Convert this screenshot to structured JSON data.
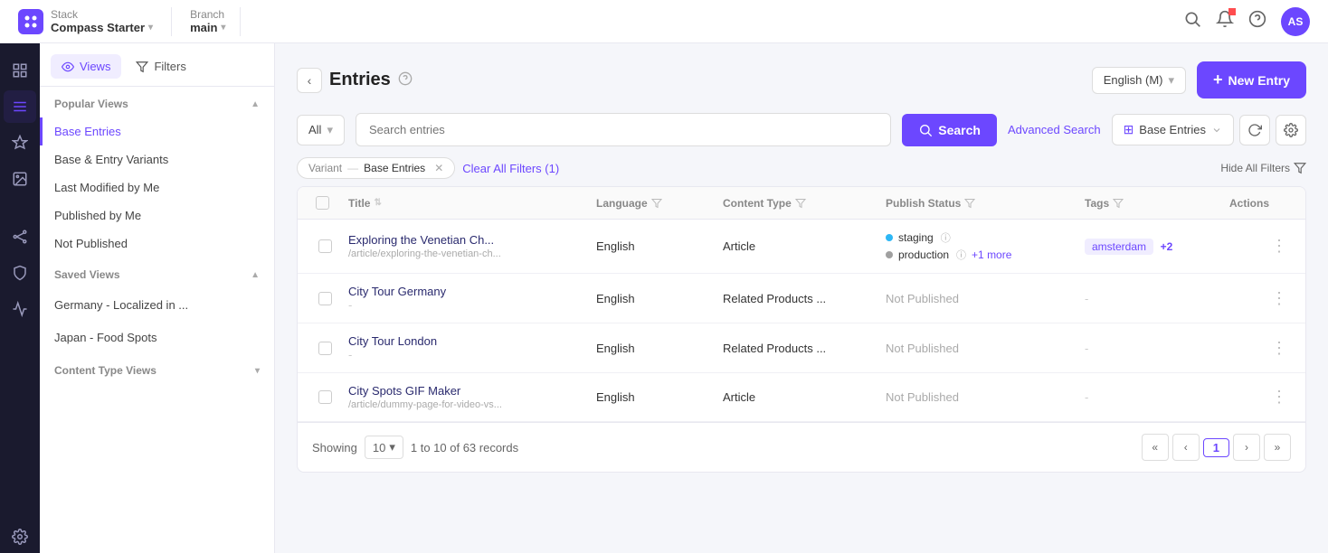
{
  "topbar": {
    "logo_text": "⊞",
    "stack_label": "Stack",
    "stack_name": "Compass Starter",
    "branch_label": "Branch",
    "branch_name": "main",
    "search_icon": "🔍",
    "notification_icon": "🔔",
    "help_icon": "?",
    "avatar": "AS"
  },
  "sidebar": {
    "views_tab": "Views",
    "filters_tab": "Filters",
    "popular_section": "Popular Views",
    "popular_items": [
      {
        "label": "Base Entries",
        "active": true
      },
      {
        "label": "Base & Entry Variants",
        "active": false
      },
      {
        "label": "Last Modified by Me",
        "active": false
      },
      {
        "label": "Published by Me",
        "active": false
      },
      {
        "label": "Not Published",
        "active": false
      }
    ],
    "saved_section": "Saved Views",
    "saved_items": [
      {
        "label": "Germany - Localized in ...",
        "active": false
      },
      {
        "label": "Japan - Food Spots",
        "active": false
      }
    ],
    "content_type_section": "Content Type Views"
  },
  "panel": {
    "back_icon": "‹",
    "title": "Entries",
    "help_icon": "?",
    "language_select": "English (M)",
    "new_entry_label": "New Entry",
    "search_type": "All",
    "search_placeholder": "Search entries",
    "search_button": "Search",
    "advanced_search": "Advanced Search",
    "view_select_label": "Base Entries",
    "filter_key": "Variant",
    "filter_dash": "—",
    "filter_value": "Base Entries",
    "clear_filters": "Clear All Filters (1)",
    "hide_filters": "Hide All Filters"
  },
  "table": {
    "headers": [
      "",
      "Title",
      "Language",
      "Content Type",
      "Publish Status",
      "Tags",
      "Actions"
    ],
    "rows": [
      {
        "title": "Exploring the Venetian Ch...",
        "path": "/article/exploring-the-venetian-ch...",
        "language": "English",
        "content_type": "Article",
        "status_dots": [
          {
            "color": "staging",
            "label": "staging"
          },
          {
            "color": "production",
            "label": "production"
          }
        ],
        "status_extra": "+1 more",
        "tags": "amsterdam",
        "tags_more": "+2"
      },
      {
        "title": "City Tour Germany",
        "path": "-",
        "language": "English",
        "content_type": "Related Products ...",
        "publish_status": "Not Published",
        "tags": "-"
      },
      {
        "title": "City Tour London",
        "path": "-",
        "language": "English",
        "content_type": "Related Products ...",
        "publish_status": "Not Published",
        "tags": "-"
      },
      {
        "title": "City Spots GIF Maker",
        "path": "/article/dummy-page-for-video-vs...",
        "language": "English",
        "content_type": "Article",
        "publish_status": "Not Published",
        "tags": "-"
      }
    ]
  },
  "pagination": {
    "showing_label": "Showing",
    "page_size": "10",
    "record_info": "1 to 10 of 63 records",
    "page_num": "1"
  }
}
